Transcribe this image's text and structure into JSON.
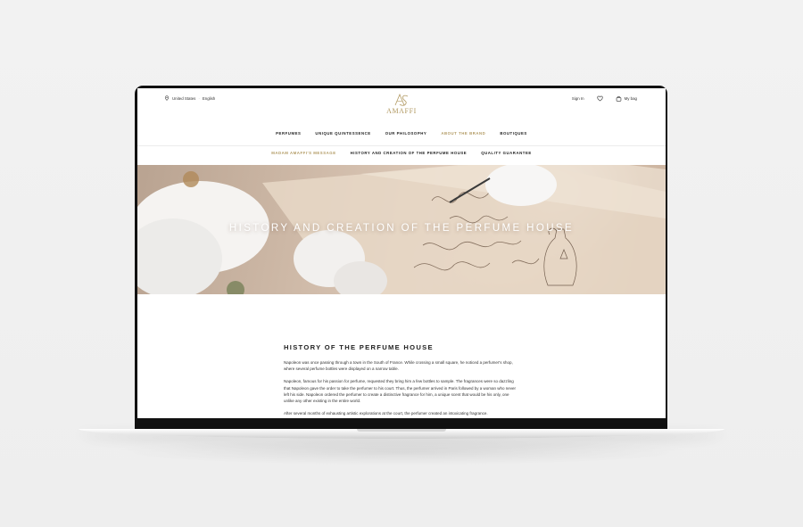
{
  "header": {
    "country": "United States",
    "language": "English",
    "sign_in": "Sign In",
    "bag": "My bag",
    "logo_text": "AMAFFI"
  },
  "main_nav": [
    {
      "label": "PERFUMES",
      "active": false
    },
    {
      "label": "UNIQUE QUINTESSENCE",
      "active": false
    },
    {
      "label": "OUR PHILOSOPHY",
      "active": false
    },
    {
      "label": "ABOUT THE BRAND",
      "active": true
    },
    {
      "label": "BOUTIQUES",
      "active": false
    }
  ],
  "sub_nav": [
    {
      "label": "MADAM AMAFFI'S MESSAGE",
      "accent": true
    },
    {
      "label": "HISTORY AND CREATION OF THE PERFUME HOUSE",
      "accent": false
    },
    {
      "label": "QUALITY GUARANTEE",
      "accent": false
    }
  ],
  "hero": {
    "title": "HISTORY AND CREATION OF THE PERFUME HOUSE"
  },
  "content": {
    "section_title": "HISTORY OF THE PERFUME HOUSE",
    "paragraphs": [
      "Napoleon was once passing through a town in the South of France. While crossing a small square, he noticed a perfumer's shop, where several perfume bottles were displayed on a narrow table.",
      "Napoleon, famous for his passion for perfume, requested they bring him a few bottles to sample. The fragrances were so dazzling that Napoleon gave the order to take the perfumer to his court. Thus, the perfumer arrived in Paris followed by a woman who never left his side. Napoleon ordered the perfumer to create a distinctive fragrance for him, a unique scent that would be his only, one unlike any other existing in the entire world.",
      "After several months of exhausting artistic explorations at the court, the perfumer created an intoxicating fragrance."
    ]
  },
  "colors": {
    "accent_gold": "#b29a63",
    "text_dark": "#222222",
    "bezel": "#111111"
  }
}
